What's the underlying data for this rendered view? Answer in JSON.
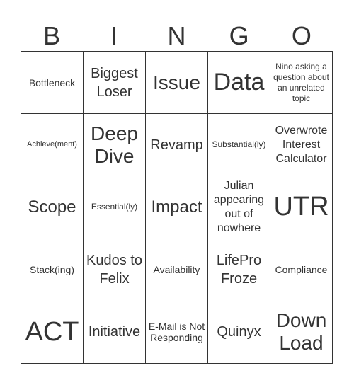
{
  "header": [
    "B",
    "I",
    "N",
    "G",
    "O"
  ],
  "cells": [
    "Bottleneck",
    "Biggest Loser",
    "Issue",
    "Data",
    "Nino asking a question about an unrelated topic",
    "Achieve(ment)",
    "Deep Dive",
    "Revamp",
    "Substantial(ly)",
    "Overwrote Interest Calculator",
    "Scope",
    "Essential(ly)",
    "Impact",
    "Julian appearing out of nowhere",
    "UTR",
    "Stack(ing)",
    "Kudos to Felix",
    "Availability",
    "LifePro Froze",
    "Compliance",
    "ACT",
    "Initiative",
    "E-Mail is Not Responding",
    "Quinyx",
    "Down Load"
  ]
}
